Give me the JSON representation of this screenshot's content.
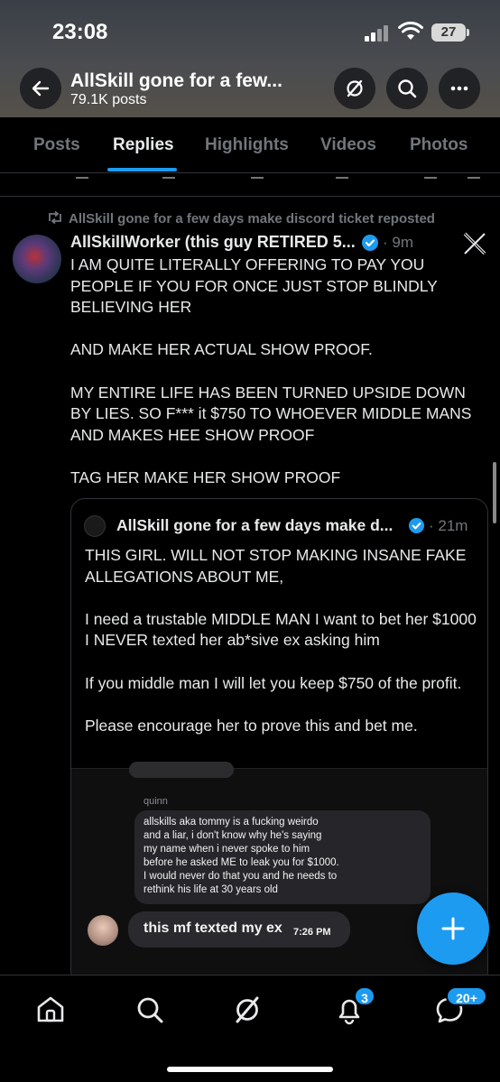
{
  "status_bar": {
    "time": "23:08",
    "battery": "27"
  },
  "header": {
    "title": "AllSkill gone for a few...",
    "subtitle": "79.1K posts",
    "icons": [
      "back-arrow-icon",
      "grok-icon",
      "search-icon",
      "more-icon"
    ]
  },
  "tabs": [
    {
      "label": "Posts",
      "active": false
    },
    {
      "label": "Replies",
      "active": true
    },
    {
      "label": "Highlights",
      "active": false
    },
    {
      "label": "Videos",
      "active": false
    },
    {
      "label": "Photos",
      "active": false
    }
  ],
  "tweet": {
    "repost_label": "AllSkill gone for a few days make discord ticket reposted",
    "author": "AllSkillWorker (this guy RETIRED 5...",
    "time": "· 9m",
    "text": "I AM QUITE LITERALLY OFFERING TO PAY YOU PEOPLE IF YOU FOR ONCE JUST STOP BLINDLY BELIEVING HER\n\nAND MAKE HER ACTUAL SHOW PROOF.\n\nMY ENTIRE LIFE HAS BEEN TURNED UPSIDE DOWN BY LIES. SO F*** it $750 TO WHOEVER MIDDLE MANS AND MAKES HEE SHOW PROOF\n\nTAG HER MAKE HER SHOW PROOF",
    "quote": {
      "author": "AllSkill gone for a few days make d...",
      "time": "· 21m",
      "text": "THIS GIRL. WILL NOT STOP MAKING INSANE FAKE ALLEGATIONS ABOUT ME,\n\nI need a trustable MIDDLE MAN I want to bet her $1000 I NEVER texted her ab*sive ex asking him\n\nIf you middle man I will let you keep $750 of the profit.\n\nPlease encourage her to prove this and bet me.",
      "media": {
        "sender_name": "quinn",
        "message": "allskills aka tommy is a fucking weirdo\nand a liar, i don't know why he's saying\nmy name when i never spoke to him\nbefore he asked ME to leak you for $1000.\nI would never do that you and he needs to\nrethink his life at 30 years old",
        "reply": "this mf texted my ex",
        "reply_time": "7:26 PM"
      }
    }
  },
  "bottom_nav": {
    "items": [
      "home-icon",
      "search-icon",
      "grok-icon",
      "notifications-icon",
      "messages-icon"
    ],
    "notifications_badge": "3",
    "messages_badge": "20+"
  },
  "colors": {
    "accent": "#1d9bf0",
    "muted": "#71767b",
    "text": "#e7e9ea",
    "divider": "#2f3336"
  }
}
